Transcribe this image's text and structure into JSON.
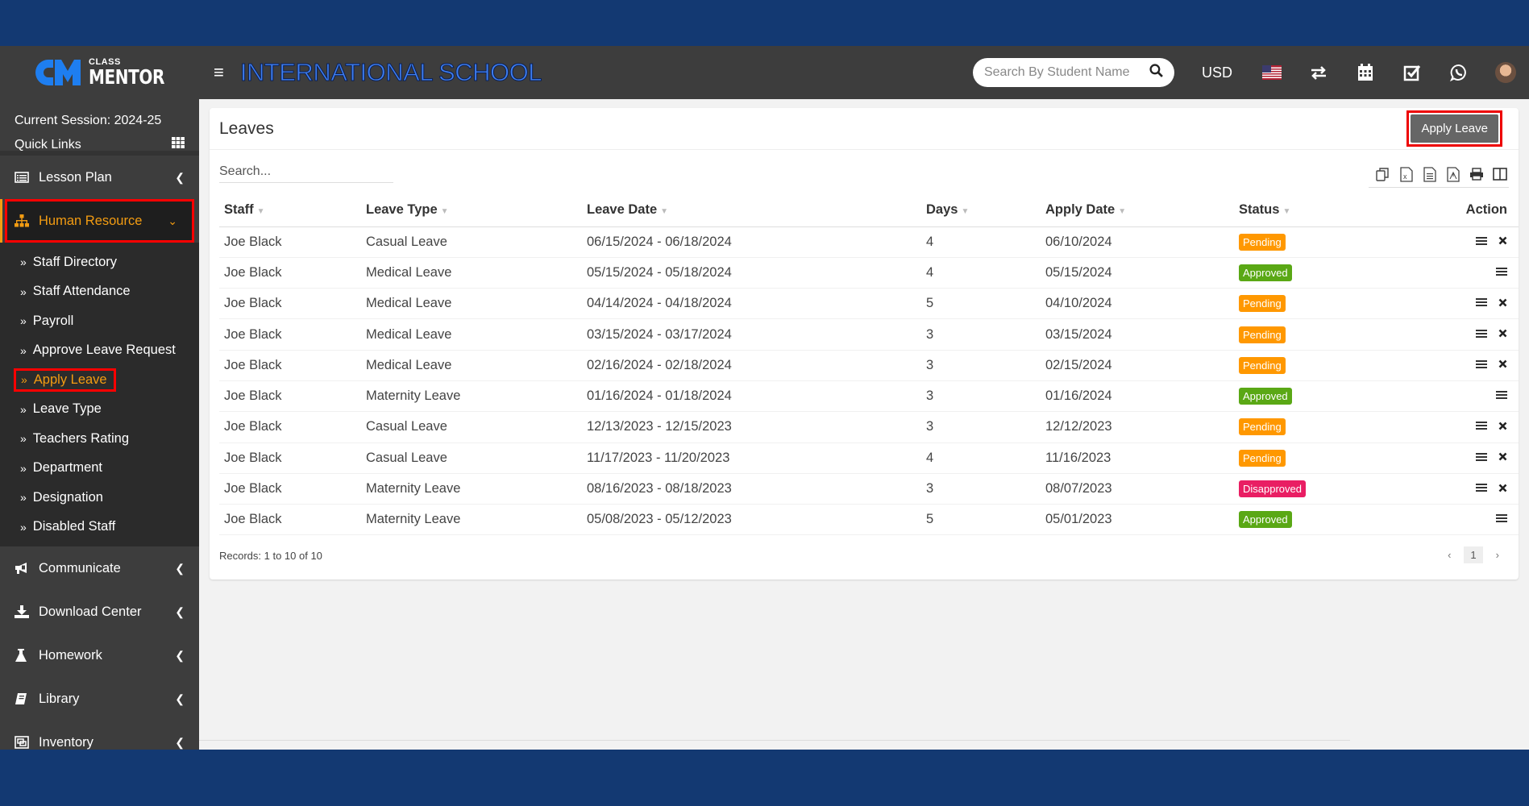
{
  "header": {
    "logo_small": "CLASS",
    "logo_big": "MENTOR",
    "school_name": "INTERNATIONAL SCHOOL",
    "search_placeholder": "Search By Student Name",
    "currency": "USD",
    "icons": [
      "flag-us-icon",
      "transfer-icon",
      "calendar-icon",
      "checkbox-icon",
      "whatsapp-icon",
      "user-avatar"
    ]
  },
  "sidebar": {
    "session": "Current Session: 2024-25",
    "quick_links": "Quick Links",
    "items_top": [
      {
        "label": "Lesson Plan",
        "icon": "lesson-plan-icon"
      },
      {
        "label": "Human Resource",
        "icon": "sitemap-icon",
        "active": true
      }
    ],
    "submenu": [
      {
        "label": "Staff Directory"
      },
      {
        "label": "Staff Attendance"
      },
      {
        "label": "Payroll"
      },
      {
        "label": "Approve Leave Request"
      },
      {
        "label": "Apply Leave",
        "active": true
      },
      {
        "label": "Leave Type"
      },
      {
        "label": "Teachers Rating"
      },
      {
        "label": "Department"
      },
      {
        "label": "Designation"
      },
      {
        "label": "Disabled Staff"
      }
    ],
    "items_bottom": [
      {
        "label": "Communicate",
        "icon": "bullhorn-icon"
      },
      {
        "label": "Download Center",
        "icon": "download-icon"
      },
      {
        "label": "Homework",
        "icon": "flask-icon"
      },
      {
        "label": "Library",
        "icon": "book-icon"
      },
      {
        "label": "Inventory",
        "icon": "object-group-icon"
      }
    ]
  },
  "main": {
    "title": "Leaves",
    "apply_button": "Apply Leave",
    "search_placeholder": "Search...",
    "export_icons": [
      "copy-icon",
      "excel-icon",
      "csv-icon",
      "pdf-icon",
      "print-icon",
      "columns-icon"
    ],
    "columns": [
      "Staff",
      "Leave Type",
      "Leave Date",
      "Days",
      "Apply Date",
      "Status",
      "Action"
    ],
    "rows": [
      {
        "staff": "Joe Black",
        "type": "Casual Leave",
        "date": "06/15/2024 - 06/18/2024",
        "days": "4",
        "apply": "06/10/2024",
        "status": "Pending",
        "cancel": true
      },
      {
        "staff": "Joe Black",
        "type": "Medical Leave",
        "date": "05/15/2024 - 05/18/2024",
        "days": "4",
        "apply": "05/15/2024",
        "status": "Approved",
        "cancel": false
      },
      {
        "staff": "Joe Black",
        "type": "Medical Leave",
        "date": "04/14/2024 - 04/18/2024",
        "days": "5",
        "apply": "04/10/2024",
        "status": "Pending",
        "cancel": true
      },
      {
        "staff": "Joe Black",
        "type": "Medical Leave",
        "date": "03/15/2024 - 03/17/2024",
        "days": "3",
        "apply": "03/15/2024",
        "status": "Pending",
        "cancel": true
      },
      {
        "staff": "Joe Black",
        "type": "Medical Leave",
        "date": "02/16/2024 - 02/18/2024",
        "days": "3",
        "apply": "02/15/2024",
        "status": "Pending",
        "cancel": true
      },
      {
        "staff": "Joe Black",
        "type": "Maternity Leave",
        "date": "01/16/2024 - 01/18/2024",
        "days": "3",
        "apply": "01/16/2024",
        "status": "Approved",
        "cancel": false
      },
      {
        "staff": "Joe Black",
        "type": "Casual Leave",
        "date": "12/13/2023 - 12/15/2023",
        "days": "3",
        "apply": "12/12/2023",
        "status": "Pending",
        "cancel": true
      },
      {
        "staff": "Joe Black",
        "type": "Casual Leave",
        "date": "11/17/2023 - 11/20/2023",
        "days": "4",
        "apply": "11/16/2023",
        "status": "Pending",
        "cancel": true
      },
      {
        "staff": "Joe Black",
        "type": "Maternity Leave",
        "date": "08/16/2023 - 08/18/2023",
        "days": "3",
        "apply": "08/07/2023",
        "status": "Disapproved",
        "cancel": true
      },
      {
        "staff": "Joe Black",
        "type": "Maternity Leave",
        "date": "05/08/2023 - 05/12/2023",
        "days": "5",
        "apply": "05/01/2023",
        "status": "Approved",
        "cancel": false
      }
    ],
    "status_colors": {
      "Pending": "#ff9800",
      "Approved": "#5aa815",
      "Disapproved": "#e91e63"
    },
    "records_text": "Records: 1 to 10 of 10",
    "pagination": {
      "prev": "‹",
      "current": "1",
      "next": "›"
    }
  },
  "colors": {
    "accent": "#f39c12",
    "brand_blue": "#1e7ef0",
    "frame_blue": "#133972",
    "highlight": "#ff0000"
  }
}
